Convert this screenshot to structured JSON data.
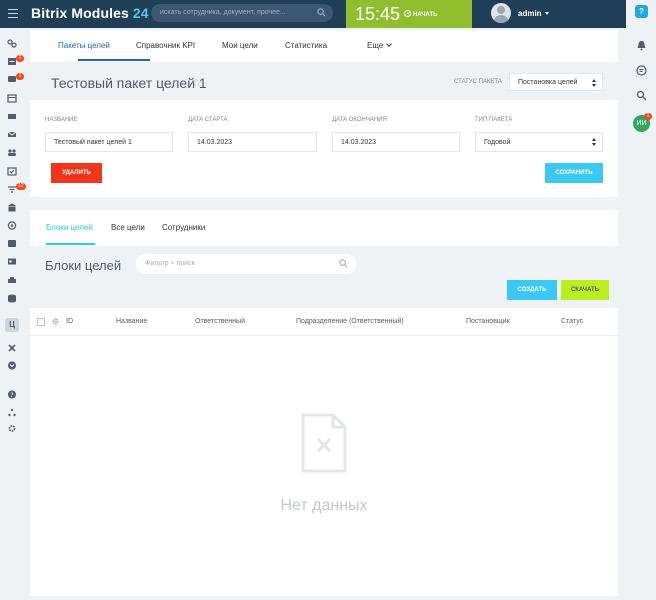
{
  "header": {
    "brand": "Bitrix Modules",
    "brand_suffix": "24",
    "search_placeholder": "искать сотрудника, документ, прочее...",
    "time": "15:45",
    "start_label": "НАЧАТЬ",
    "user_name": "admin"
  },
  "left_sidebar": {
    "badges": [
      "1",
      "1",
      "12"
    ]
  },
  "right_sidebar": {
    "help": "?",
    "avatar_initials": "ИИ",
    "avatar_badge": "1"
  },
  "tabs": {
    "items": [
      "Пакеты целей",
      "Справочник KPI",
      "Мои цели",
      "Статистика"
    ],
    "more": "Еще",
    "active_index": 0
  },
  "page": {
    "title": "Тестовый пакет целей 1",
    "status_label": "СТАТУС ПАКЕТА",
    "status_value": "Постановка целей"
  },
  "form": {
    "name_label": "НАЗВАНИЕ",
    "name_value": "Тестовый пакет целей 1",
    "start_label": "ДАТА СТАРТА",
    "start_value": "14.03.2023",
    "end_label": "ДАТА ОКОНЧАНИЯ",
    "end_value": "14.03.2023",
    "type_label": "ТИП ПАКЕТА",
    "type_value": "Годовой",
    "delete_label": "УДАЛИТЬ",
    "save_label": "СОХРАНИТЬ"
  },
  "subtabs": {
    "items": [
      "Блоки целей",
      "Все цели",
      "Сотрудники"
    ],
    "active_index": 0
  },
  "blocks": {
    "title": "Блоки целей",
    "filter_placeholder": "Фильтр + поиск",
    "create_label": "СОЗДАТЬ",
    "download_label": "СКАЧАТЬ"
  },
  "grid": {
    "columns": [
      "ID",
      "Название",
      "Ответственный",
      "Подразделение (Ответственный)",
      "Постановщик",
      "Статус"
    ],
    "empty_text": "Нет данных"
  },
  "colors": {
    "header_bg": "#1f3f57",
    "clock_bg": "#8fbe2e",
    "primary": "#3bc8f5",
    "danger": "#f1361b",
    "download": "#bbed21",
    "tab_active": "#2066b0"
  }
}
